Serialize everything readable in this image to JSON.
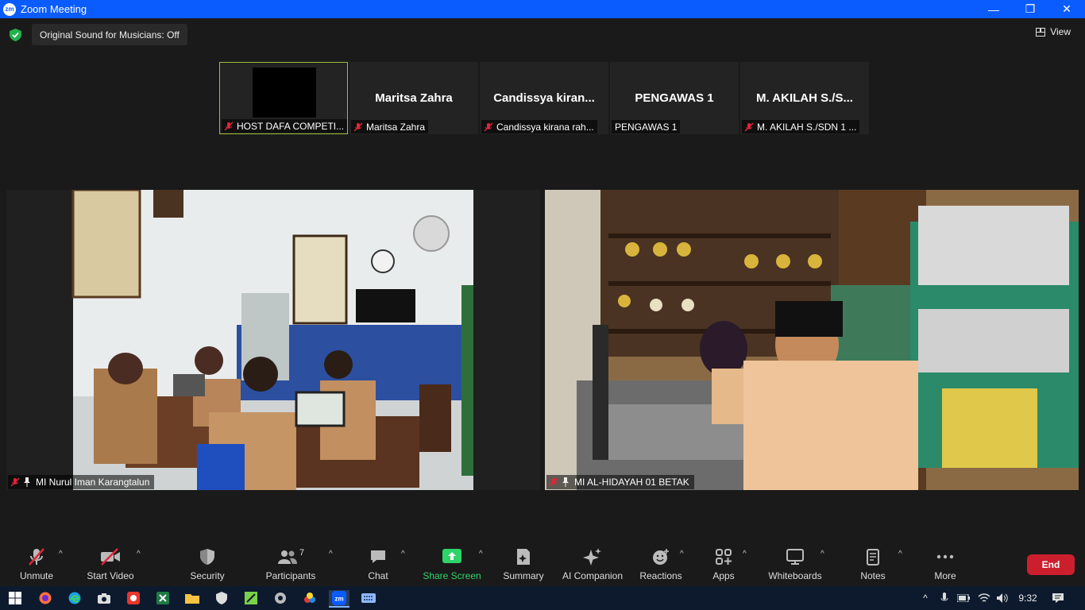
{
  "window": {
    "title": "Zoom Meeting",
    "minimize": "—",
    "restore": "❐",
    "close": "✕"
  },
  "top": {
    "original_sound": "Original Sound for Musicians: Off",
    "view_label": "View"
  },
  "strip": [
    {
      "name": "",
      "label": "HOST DAFA COMPETI...",
      "muted": true,
      "active": true,
      "video_off_black": true
    },
    {
      "name": "Maritsa Zahra",
      "label": "Maritsa Zahra",
      "muted": true
    },
    {
      "name": "Candissya  kiran...",
      "label": "Candissya kirana rah...",
      "muted": true
    },
    {
      "name": "PENGAWAS 1",
      "label": "PENGAWAS 1",
      "muted": false
    },
    {
      "name": "M. AKILAH S./S...",
      "label": "M. AKILAH S./SDN 1 ...",
      "muted": true
    }
  ],
  "videos": [
    {
      "label": "MI Nurul Iman Karangtalun"
    },
    {
      "label": "MI AL-HIDAYAH 01 BETAK"
    }
  ],
  "toolbar": {
    "unmute": "Unmute",
    "start_video": "Start Video",
    "security": "Security",
    "participants": "Participants",
    "participants_count": "7",
    "chat": "Chat",
    "share_screen": "Share Screen",
    "summary": "Summary",
    "ai_companion": "AI Companion",
    "reactions": "Reactions",
    "apps": "Apps",
    "whiteboards": "Whiteboards",
    "notes": "Notes",
    "more": "More",
    "end": "End"
  },
  "taskbar": {
    "time": "9:32"
  },
  "colors": {
    "accent": "#0b5cff",
    "end": "#cc1f2d",
    "share": "#2dd46a",
    "mute": "#e0263a"
  }
}
